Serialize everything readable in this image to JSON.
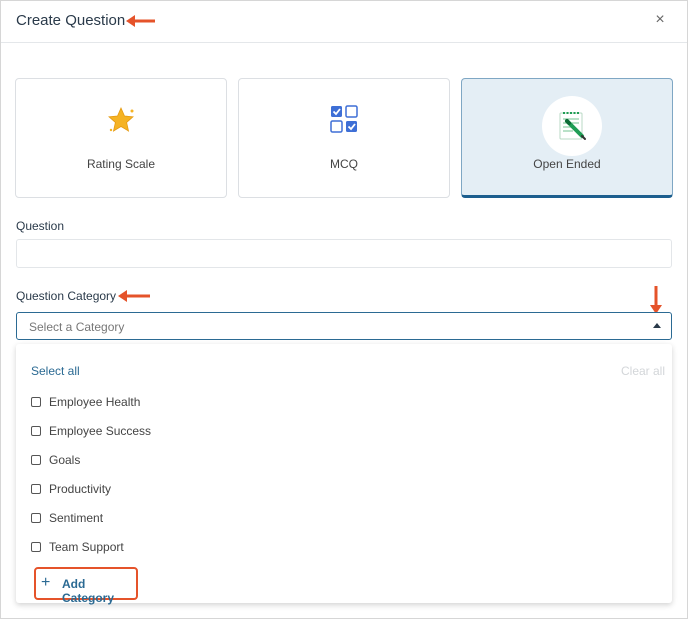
{
  "modal": {
    "title": "Create Question",
    "close_symbol": "×"
  },
  "question_types": [
    {
      "label": "Rating Scale",
      "icon": "star-icon",
      "selected": false
    },
    {
      "label": "MCQ",
      "icon": "checkbox-grid-icon",
      "selected": false
    },
    {
      "label": "Open Ended",
      "icon": "notepad-pencil-icon",
      "selected": true
    }
  ],
  "question_field": {
    "label": "Question",
    "value": "",
    "placeholder": ""
  },
  "category_field": {
    "label": "Question Category",
    "placeholder": "Select a Category"
  },
  "dropdown": {
    "select_all": "Select all",
    "clear_all": "Clear all",
    "options": [
      "Employee Health",
      "Employee Success",
      "Goals",
      "Productivity",
      "Sentiment",
      "Team Support"
    ],
    "add_category": "Add Category",
    "add_symbol": "+"
  },
  "colors": {
    "accent": "#2b6a93",
    "selected_card_bg": "#e4eef5",
    "selected_card_border": "#1c5e8e",
    "annotation_arrow": "#e5532a",
    "star": "#f5b324",
    "mcq_blue": "#3e6fd6",
    "pencil_green": "#1f9d55"
  }
}
